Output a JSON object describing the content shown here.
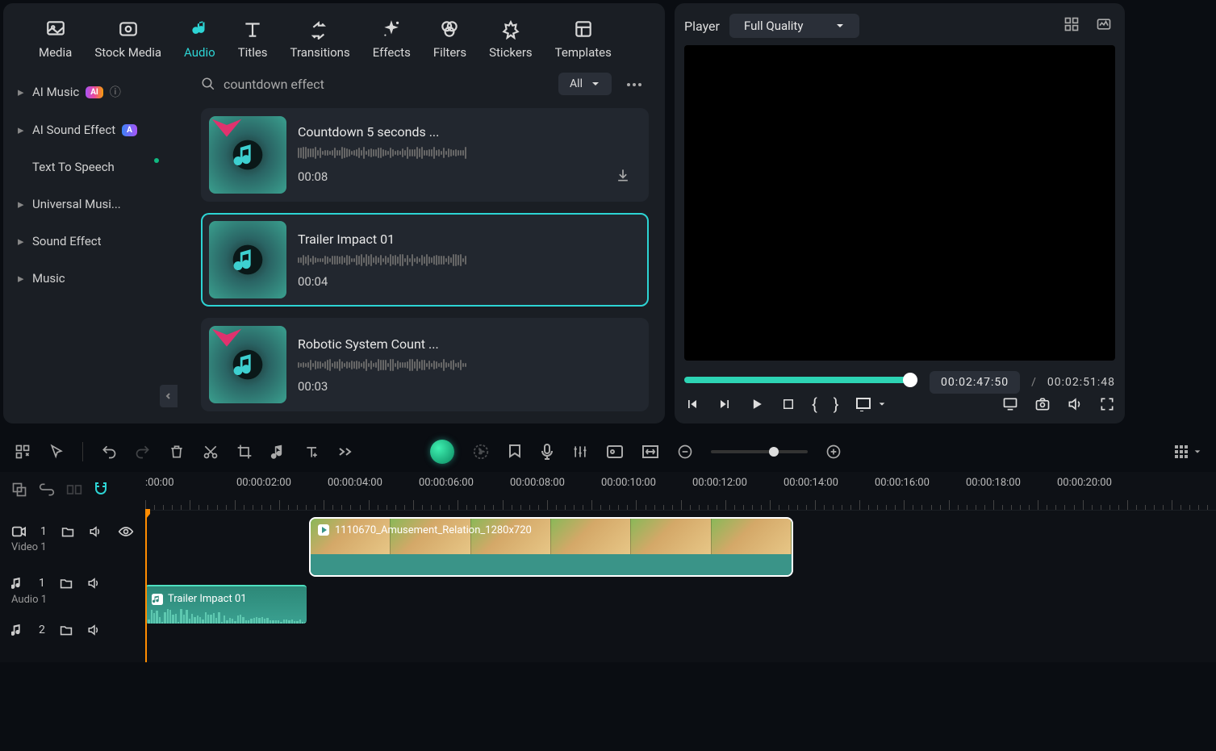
{
  "tabs": {
    "media": "Media",
    "stock": "Stock Media",
    "audio": "Audio",
    "titles": "Titles",
    "transitions": "Transitions",
    "effects": "Effects",
    "filters": "Filters",
    "stickers": "Stickers",
    "templates": "Templates"
  },
  "sidebar": {
    "items": [
      {
        "label": "AI Music",
        "badge": "AI",
        "info": true
      },
      {
        "label": "AI Sound Effect",
        "badge": "A"
      },
      {
        "label": "Text To Speech",
        "dot": true
      },
      {
        "label": "Universal Musi..."
      },
      {
        "label": "Sound Effect"
      },
      {
        "label": "Music"
      }
    ]
  },
  "search": {
    "query": "countdown effect",
    "filter": "All"
  },
  "audio_results": [
    {
      "title": "Countdown 5 seconds ...",
      "duration": "00:08",
      "gem": true,
      "download": true
    },
    {
      "title": "Trailer Impact 01",
      "duration": "00:04",
      "selected": true
    },
    {
      "title": "Robotic System Count ...",
      "duration": "00:03",
      "gem": true
    }
  ],
  "player": {
    "label": "Player",
    "quality": "Full Quality",
    "current_time": "00:02:47:50",
    "total_time": "00:02:51:48"
  },
  "timeline": {
    "marks": [
      ":00:00",
      "00:00:02:00",
      "00:00:04:00",
      "00:00:06:00",
      "00:00:08:00",
      "00:00:10:00",
      "00:00:12:00",
      "00:00:14:00",
      "00:00:16:00",
      "00:00:18:00",
      "00:00:20:00"
    ],
    "tracks": {
      "video1": {
        "label": "Video 1",
        "num": "1",
        "clip": "1110670_Amusement_Relation_1280x720"
      },
      "audio1": {
        "label": "Audio 1",
        "num": "1",
        "clip": "Trailer Impact 01"
      },
      "audio2": {
        "num": "2"
      }
    }
  }
}
